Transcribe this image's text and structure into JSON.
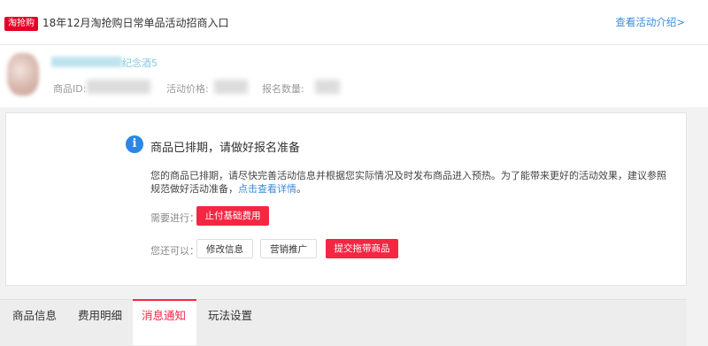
{
  "header": {
    "tag": "淘抢购",
    "title": "18年12月淘抢购日常单品活动招商入口",
    "intro_link": "查看活动介绍>"
  },
  "product": {
    "name_visible": "纪念酒5",
    "id_label": "商品ID:",
    "price_label": "活动价格:",
    "quantity_label": "报名数量:"
  },
  "notice": {
    "icon": "i",
    "title": "商品已排期，请做好报名准备",
    "description": "您的商品已排期，请尽快完善活动信息并根据您实际情况及时发布商品进入预热。为了能带来更好的活动效果，建议参照规范做好活动准备，",
    "description_link": "点击查看详情",
    "description_end": "。",
    "todo_label": "需要进行：",
    "pay_button": "止付基础费用",
    "optional_label": "您还可以：",
    "edit_button": "修改信息",
    "marketing_button": "营销推广",
    "submit_button": "提交拖带商品"
  },
  "tabs": [
    "商品信息",
    "费用明细",
    "消息通知",
    "玩法设置"
  ],
  "active_tab": "消息通知"
}
